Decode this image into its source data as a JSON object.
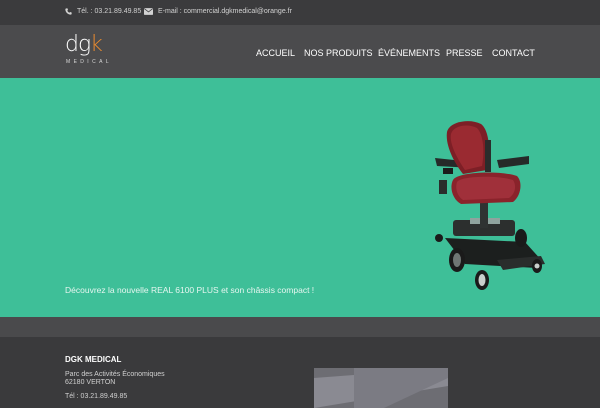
{
  "topbar": {
    "phone_icon": "phone-icon",
    "phone_text": "Tél. : 03.21.89.49.85",
    "email_icon": "envelope-icon",
    "email_text": "E-mail : commercial.dgkmedical@orange.fr"
  },
  "header": {
    "logo": {
      "letters_main": "dg",
      "letters_accent": "k",
      "sub": "MEDICAL"
    },
    "nav": [
      "ACCUEIL",
      "NOS PRODUITS",
      "ÉVÉNEMENTS",
      "PRESSE",
      "CONTACT"
    ]
  },
  "hero": {
    "caption": "Découvrez la nouvelle REAL 6100 PLUS et son châssis compact !"
  },
  "footer": {
    "company": "DGK MEDICAL",
    "address_line1": "Parc des Activités Économiques",
    "address_line2": "62180 VERTON",
    "phone": "Tél : 03.21.89.49.85"
  },
  "colors": {
    "hero_bg": "#3ebf98",
    "header_bg": "#4b4b4d",
    "topbar_bg": "#3b3b3d",
    "footer_bg": "#3a3a3c",
    "logo_accent": "#e88a2f"
  }
}
